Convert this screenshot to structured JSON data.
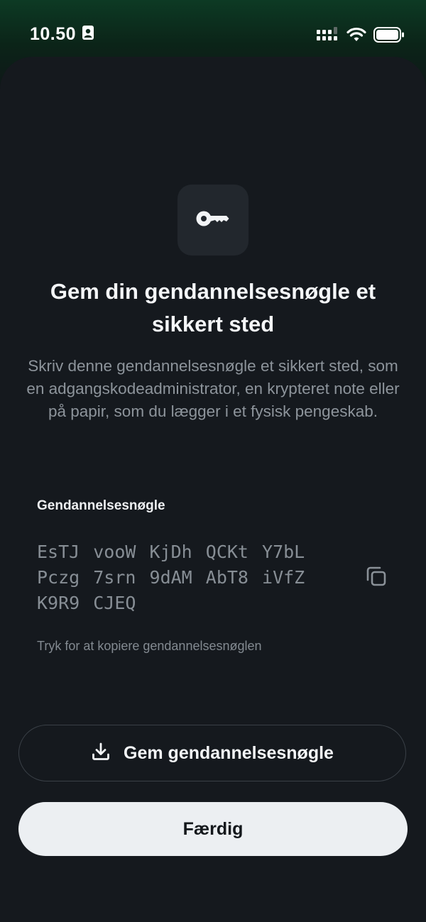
{
  "status_bar": {
    "time": "10.50",
    "icons": [
      "contact-card-icon",
      "cellular-signal-icon",
      "wifi-icon",
      "battery-icon"
    ]
  },
  "dialog": {
    "icon": "key-icon",
    "title": "Gem din gendannelsesnøgle et sikkert sted",
    "description": "Skriv denne gendannelsesnøgle et sikkert sted, som en adgangskodeadministrator, en krypteret note eller på papir, som du lægger i et fysisk pengeskab.",
    "key_label": "Gendannelsesnøgle",
    "recovery_key": "EsTJ vooW KjDh QCKt Y7bL Pczg 7srn 9dAM AbT8 iVfZ K9R9 CJEQ",
    "copy_icon": "copy-icon",
    "copy_hint": "Tryk for at kopiere gendannelsesnøglen"
  },
  "buttons": {
    "save_label": "Gem gendannelsesnøgle",
    "save_icon": "download-icon",
    "done_label": "Færdig"
  },
  "colors": {
    "background": "#101418",
    "sheet": "#15191e",
    "accent_glow": "#0d3a24",
    "primary_button": "#eceff2",
    "muted_text": "#8d949b"
  }
}
